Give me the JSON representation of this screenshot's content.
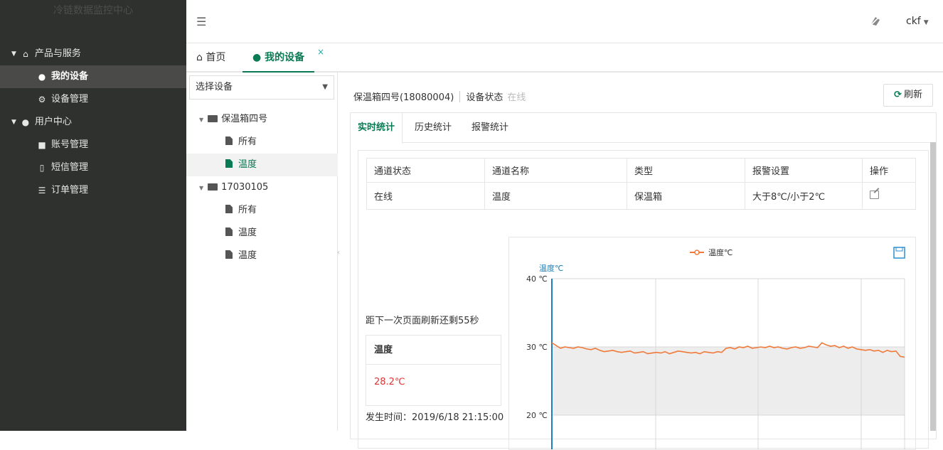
{
  "app": {
    "brand": "冷链数据监控中心"
  },
  "sidebar": {
    "groups": [
      {
        "label": "产品与服务",
        "icon": "home-icon",
        "items": [
          {
            "label": "我的设备",
            "icon": "user-icon",
            "active": true
          },
          {
            "label": "设备管理",
            "icon": "gear-icon",
            "active": false
          }
        ]
      },
      {
        "label": "用户中心",
        "icon": "user-icon",
        "items": [
          {
            "label": "账号管理",
            "icon": "folder-icon",
            "active": false
          },
          {
            "label": "短信管理",
            "icon": "mobile-icon",
            "active": false
          },
          {
            "label": "订单管理",
            "icon": "list-icon",
            "active": false
          }
        ]
      }
    ]
  },
  "header": {
    "user": "ckf"
  },
  "tabs": [
    {
      "label": "首页",
      "icon": "home-icon",
      "active": false
    },
    {
      "label": "我的设备",
      "icon": "user-icon",
      "active": true,
      "closable": true
    }
  ],
  "tree": {
    "select_placeholder": "选择设备",
    "nodes": [
      {
        "label": "保温箱四号",
        "type": "folder",
        "children": [
          {
            "label": "所有",
            "active": false
          },
          {
            "label": "温度",
            "active": true
          }
        ]
      },
      {
        "label": "17030105",
        "type": "folder",
        "children": [
          {
            "label": "所有",
            "active": false
          },
          {
            "label": "温度",
            "active": false
          },
          {
            "label": "温度",
            "active": false
          }
        ]
      }
    ]
  },
  "main": {
    "device_name": "保温箱四号(18080004)",
    "status_label": "设备状态",
    "status_value": "在线",
    "refresh_label": "刷新",
    "stat_tabs": [
      "实时统计",
      "历史统计",
      "报警统计"
    ],
    "table": {
      "headers": [
        "通道状态",
        "通道名称",
        "类型",
        "报警设置",
        "操作"
      ],
      "rows": [
        [
          "在线",
          "温度",
          "保温箱",
          "大于8℃/小于2℃",
          ""
        ]
      ]
    },
    "countdown": "距下一次页面刷新还剩55秒",
    "temp_card": {
      "title": "温度",
      "value": "28.2℃"
    },
    "occur_time": "发生时间：2019/6/18 21:15:00"
  },
  "chart_data": {
    "type": "line",
    "legend": "温度℃",
    "ylabel": "温度℃",
    "ylim": [
      20,
      40
    ],
    "yticks": [
      "40 ℃",
      "30 ℃",
      "20 ℃"
    ],
    "series": [
      {
        "name": "温度℃",
        "color": "#f07a3a",
        "values": [
          30.6,
          30.2,
          29.8,
          30.0,
          29.9,
          29.8,
          30.0,
          29.9,
          29.7,
          29.6,
          29.8,
          29.5,
          29.3,
          29.4,
          29.5,
          29.3,
          29.2,
          29.3,
          29.4,
          29.1,
          29.2,
          29.3,
          29.0,
          29.1,
          29.2,
          29.1,
          29.3,
          29.0,
          29.2,
          29.4,
          29.3,
          29.2,
          29.1,
          29.2,
          29.0,
          29.3,
          29.2,
          29.1,
          29.3,
          29.2,
          29.8,
          29.9,
          29.7,
          30.0,
          29.9,
          30.1,
          29.8,
          29.9,
          30.0,
          29.9,
          30.1,
          29.9,
          30.0,
          29.8,
          29.7,
          29.9,
          30.0,
          29.8,
          29.9,
          30.1,
          30.0,
          29.9,
          30.6,
          30.3,
          30.1,
          30.2,
          29.9,
          30.1,
          29.8,
          30.0,
          29.7,
          29.6,
          29.5,
          29.6,
          29.4,
          29.5,
          29.2,
          29.5,
          29.3,
          29.4,
          28.6,
          28.5
        ]
      }
    ]
  }
}
